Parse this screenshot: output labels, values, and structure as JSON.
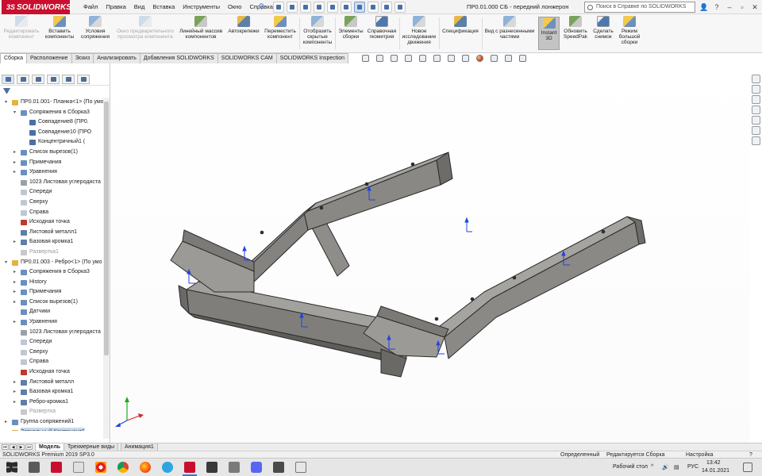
{
  "app": {
    "logo_text": "SOLIDWORKS",
    "document_title": "ПР0.01.000 СБ - передний лонжерон"
  },
  "menu": [
    "Файл",
    "Правка",
    "Вид",
    "Вставка",
    "Инструменты",
    "Окно",
    "Справка"
  ],
  "help_search": {
    "placeholder": "Поиск в Справке по SOLIDWORKS"
  },
  "ribbon": [
    {
      "label": "Редактировать компонент",
      "disabled": true,
      "icon": "edit-component-icon"
    },
    {
      "label": "Вставить компоненты",
      "disabled": false,
      "icon": "insert-components-icon"
    },
    {
      "label": "Условия сопряжения",
      "disabled": false,
      "icon": "mate-icon"
    },
    {
      "label": "Окно предварительного просмотра компонента",
      "disabled": true,
      "icon": "preview-window-icon"
    },
    {
      "label": "Линейный массив компонентов",
      "disabled": false,
      "icon": "linear-pattern-icon"
    },
    {
      "label": "Автокрепежи",
      "disabled": false,
      "icon": "smart-fasteners-icon"
    },
    {
      "label": "Переместить компонент",
      "disabled": false,
      "icon": "move-component-icon"
    },
    {
      "label": "Отобразить скрытые компоненты",
      "disabled": false,
      "icon": "show-hidden-icon"
    },
    {
      "label": "Элементы сборки",
      "disabled": false,
      "icon": "assembly-features-icon"
    },
    {
      "label": "Справочная геометрия",
      "disabled": false,
      "icon": "reference-geometry-icon"
    },
    {
      "label": "Новое исследование движения",
      "disabled": false,
      "icon": "motion-study-icon"
    },
    {
      "label": "Спецификация",
      "disabled": false,
      "icon": "bom-icon"
    },
    {
      "label": "Вид с разнесенными частями",
      "disabled": false,
      "icon": "exploded-view-icon"
    },
    {
      "label": "Instant 3D",
      "disabled": false,
      "selected": true,
      "icon": "instant-3d-icon"
    },
    {
      "label": "Обновить SpeedPak",
      "disabled": false,
      "icon": "speedpak-icon"
    },
    {
      "label": "Сделать снимок",
      "disabled": false,
      "icon": "snapshot-icon"
    },
    {
      "label": "Режим большой сборки",
      "disabled": false,
      "icon": "large-assembly-icon"
    }
  ],
  "command_tabs": [
    "Сборка",
    "Расположение",
    "Эскиз",
    "Анализировать",
    "Добавления SOLIDWORKS",
    "SOLIDWORKS CAM",
    "SOLIDWORKS Inspection"
  ],
  "active_command_tab": "Сборка",
  "tree": [
    {
      "label": "ПР0.01.001- Планка<1> (По умо",
      "level": 0,
      "expanded": true,
      "icon": "part-icon"
    },
    {
      "label": "Сопряжения в Сборка3",
      "level": 1,
      "expanded": true,
      "icon": "mates-folder-icon"
    },
    {
      "label": "Совпадение8 (ПР0.",
      "level": 2,
      "icon": "coincident-mate-icon"
    },
    {
      "label": "Совпадение10 (ПРО",
      "level": 2,
      "icon": "coincident-mate-icon"
    },
    {
      "label": "Концентричный1 (",
      "level": 2,
      "icon": "concentric-mate-icon"
    },
    {
      "label": "Список вырезов(1)",
      "level": 1,
      "expanded": false,
      "icon": "cut-list-icon"
    },
    {
      "label": "Примечания",
      "level": 1,
      "expanded": false,
      "icon": "annotations-icon"
    },
    {
      "label": "Уравнения",
      "level": 1,
      "expanded": false,
      "icon": "equations-icon"
    },
    {
      "label": "1023 Листовая углеродиста",
      "level": 1,
      "icon": "material-icon"
    },
    {
      "label": "Спереди",
      "level": 1,
      "icon": "plane-icon"
    },
    {
      "label": "Сверху",
      "level": 1,
      "icon": "plane-icon"
    },
    {
      "label": "Справа",
      "level": 1,
      "icon": "plane-icon"
    },
    {
      "label": "Исходная точка",
      "level": 1,
      "icon": "origin-icon"
    },
    {
      "label": "Листовой металл1",
      "level": 1,
      "icon": "sheet-metal-icon"
    },
    {
      "label": "Базовая кромка1",
      "level": 1,
      "expanded": false,
      "icon": "base-flange-icon"
    },
    {
      "label": "Развертка1",
      "level": 1,
      "gray": true,
      "icon": "flat-pattern-icon"
    },
    {
      "label": "ПР0.01.003 - Ребро<1> (По умо",
      "level": 0,
      "expanded": true,
      "icon": "part-icon"
    },
    {
      "label": "Сопряжения в Сборка3",
      "level": 1,
      "expanded": false,
      "icon": "mates-folder-icon"
    },
    {
      "label": "History",
      "level": 1,
      "expanded": false,
      "icon": "history-icon"
    },
    {
      "label": "Примечания",
      "level": 1,
      "expanded": false,
      "icon": "annotations-icon"
    },
    {
      "label": "Список вырезов(1)",
      "level": 1,
      "expanded": false,
      "icon": "cut-list-icon"
    },
    {
      "label": "Датчики",
      "level": 1,
      "icon": "sensors-icon"
    },
    {
      "label": "Уравнения",
      "level": 1,
      "expanded": false,
      "icon": "equations-icon"
    },
    {
      "label": "1023 Листовая углеродиста",
      "level": 1,
      "icon": "material-icon"
    },
    {
      "label": "Спереди",
      "level": 1,
      "icon": "plane-icon"
    },
    {
      "label": "Сверху",
      "level": 1,
      "icon": "plane-icon"
    },
    {
      "label": "Справа",
      "level": 1,
      "icon": "plane-icon"
    },
    {
      "label": "Исходная точка",
      "level": 1,
      "icon": "origin-icon"
    },
    {
      "label": "Листовой металл",
      "level": 1,
      "expanded": false,
      "icon": "sheet-metal-icon"
    },
    {
      "label": "Базовая кромка1",
      "level": 1,
      "expanded": false,
      "icon": "base-flange-icon"
    },
    {
      "label": "Ребро-кромка1",
      "level": 1,
      "expanded": false,
      "icon": "edge-flange-icon"
    },
    {
      "label": "Развертка",
      "level": 1,
      "gray": true,
      "icon": "flat-pattern-icon"
    },
    {
      "label": "Группа сопряжений1",
      "level": 0,
      "expanded": false,
      "icon": "mate-group-icon"
    },
    {
      "label": "Зеркальный Компонент1",
      "level": 0,
      "expanded": false,
      "highlighted": true,
      "icon": "mirror-component-icon"
    }
  ],
  "bottom_tabs": [
    "Модель",
    "Трехмерные виды",
    "Анимация1"
  ],
  "active_bottom_tab": "Модель",
  "status": {
    "product": "SOLIDWORKS Premium 2019 SP3.0",
    "defined": "Определенный",
    "editing": "Редактируется Сборка",
    "setting": "Настройка"
  },
  "taskbar": {
    "desktop_label": "Рабочий стол",
    "lang": "РУС",
    "time": "13:42",
    "date": "14.01.2021"
  },
  "colors": {
    "brand": "#c8102e",
    "model_face": "#8c8a86",
    "model_edge": "#2b2b2b",
    "axis_blue": "#2244dd"
  }
}
